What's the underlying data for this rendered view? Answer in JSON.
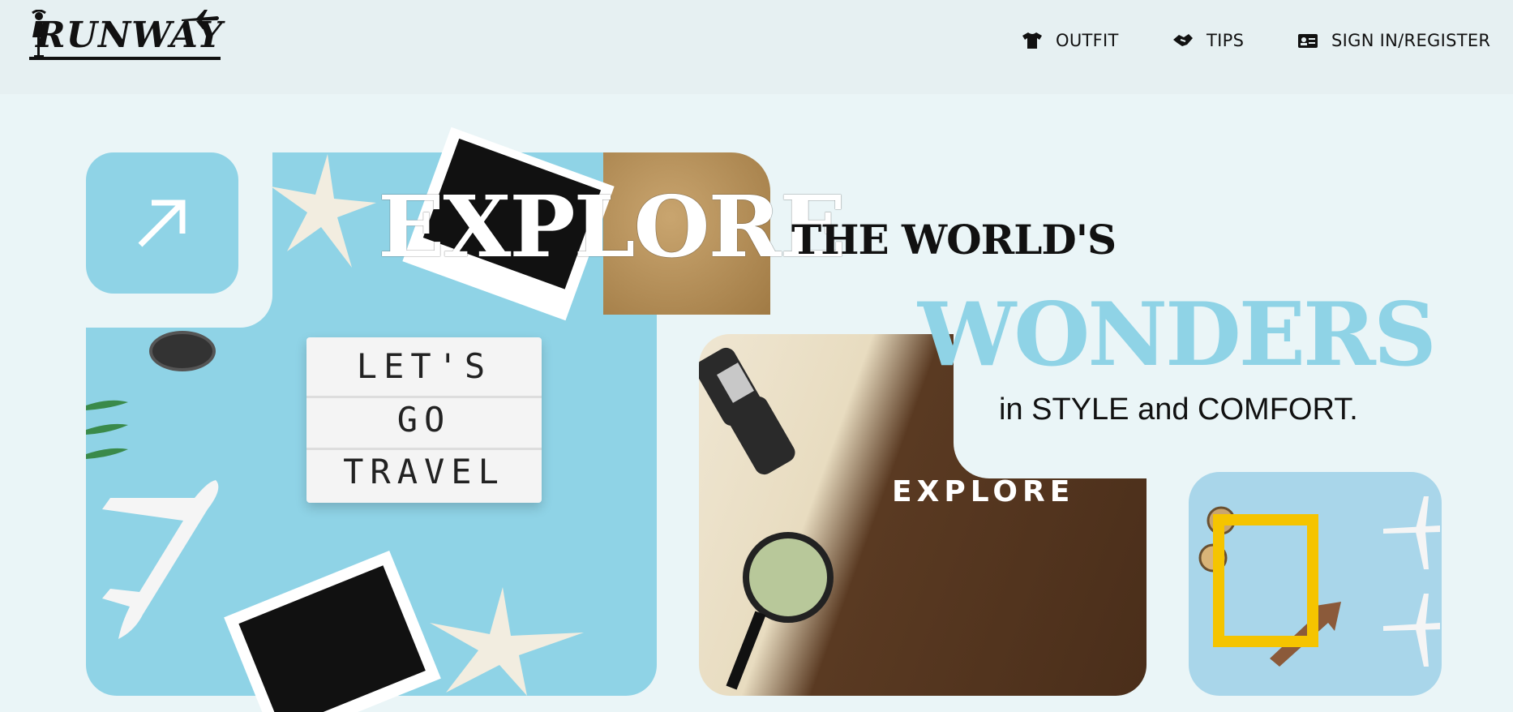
{
  "brand": {
    "logo_text": "RUNWAY"
  },
  "nav": {
    "items": [
      {
        "label": "OUTFIT",
        "icon": "tshirt-icon"
      },
      {
        "label": "TIPS",
        "icon": "handshake-icon"
      },
      {
        "label": "SIGN IN/REGISTER",
        "icon": "id-card-icon"
      }
    ]
  },
  "hero": {
    "headline_1": "EXPLORE",
    "headline_2": "THE WORLD'S",
    "headline_3": "WONDERS",
    "subheadline": "in STYLE and COMFORT.",
    "arrow_icon": "arrow-up-right-icon"
  },
  "photos": {
    "left": {
      "lightbox_lines": [
        "LET'S",
        "GO",
        "TRAVEL"
      ]
    },
    "middle": {
      "sign_text": "EXPLORE"
    }
  },
  "colors": {
    "accent": "#8fd3e6",
    "background": "#eaf5f7",
    "header": "#e6f0f2",
    "text": "#111111",
    "yellow": "#f5c400"
  }
}
